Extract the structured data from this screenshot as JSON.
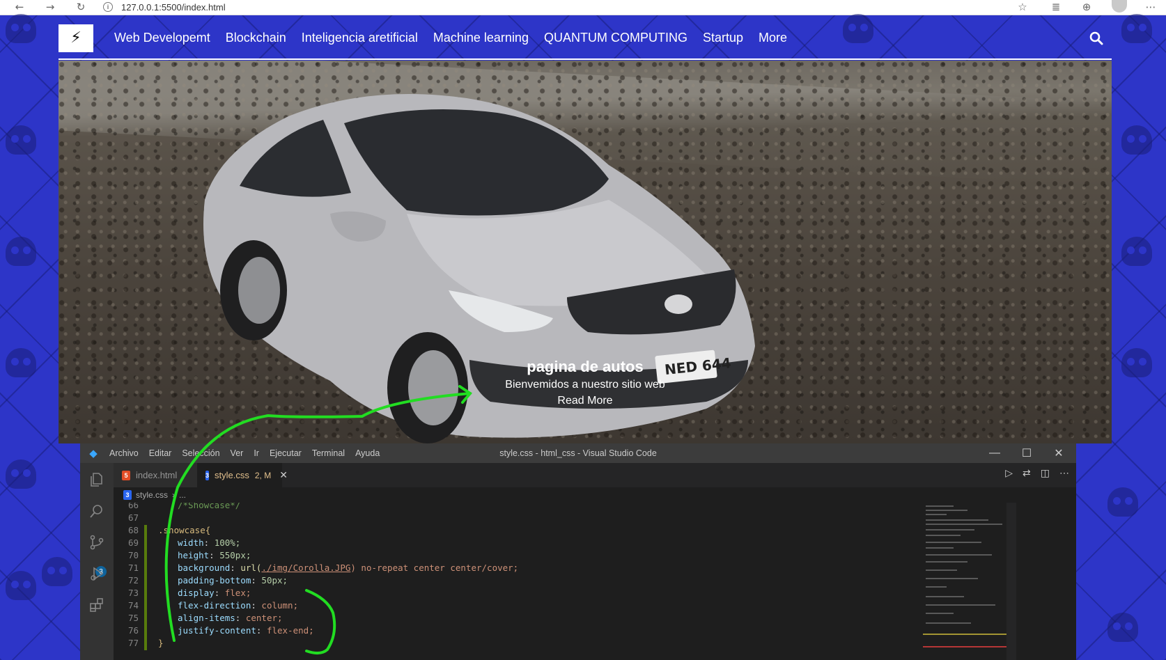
{
  "browser": {
    "url": "127.0.0.1:5500/index.html"
  },
  "site": {
    "nav_items": [
      "Web Developemt",
      "Blockchain",
      "Inteligencia aretificial",
      "Machine learning",
      "QUANTUM COMPUTING",
      "Startup",
      "More"
    ],
    "hero_title": "pagina de autos",
    "hero_subtitle": "Bienvemidos a nuestro sitio web",
    "hero_link": "Read More",
    "license_plate": "NED 644"
  },
  "vscode": {
    "menu": [
      "Archivo",
      "Editar",
      "Selección",
      "Ver",
      "Ir",
      "Ejecutar",
      "Terminal",
      "Ayuda"
    ],
    "window_title": "style.css - html_css - Visual Studio Code",
    "tabs": [
      {
        "label": "index.html",
        "icon": "html5-icon"
      },
      {
        "label": "style.css",
        "status": "2, M",
        "icon": "css3-icon"
      }
    ],
    "breadcrumb": {
      "file": "style.css",
      "rest": "..."
    },
    "scm_badge": "3",
    "code_lines": [
      {
        "n": "66",
        "text": "/*Showcase*/"
      },
      {
        "n": "67",
        "text": ""
      },
      {
        "n": "68",
        "text": ".showcase{"
      },
      {
        "n": "69",
        "prop": "width",
        "value": "100%;"
      },
      {
        "n": "70",
        "prop": "height",
        "value": "550px;"
      },
      {
        "n": "71",
        "prop": "background",
        "fn": "url(",
        "url": "./img/Corolla.JPG",
        "rest": ") no-repeat center center/cover;"
      },
      {
        "n": "72",
        "prop": "padding-bottom",
        "value": "50px;"
      },
      {
        "n": "73",
        "prop": "display",
        "value": "flex;"
      },
      {
        "n": "74",
        "prop": "flex-direction",
        "value": "column;"
      },
      {
        "n": "75",
        "prop": "align-items",
        "value": "center;"
      },
      {
        "n": "76",
        "prop": "justify-content",
        "value": "flex-end;"
      },
      {
        "n": "77",
        "text": "}"
      }
    ]
  },
  "colors": {
    "page_bg": "#2d35c8",
    "annotation": "#22dd22",
    "vscode_bg": "#1e1e1e"
  }
}
